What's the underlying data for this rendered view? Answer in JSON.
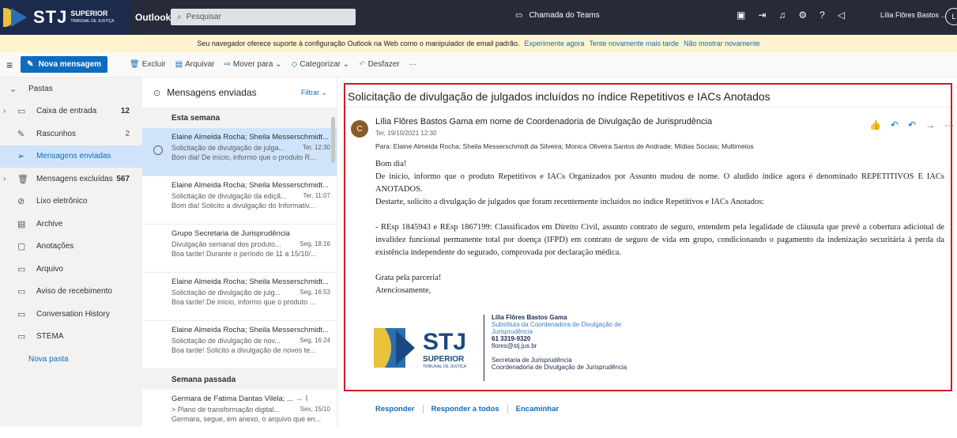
{
  "header": {
    "org": "STJ",
    "org_sub": "SUPERIOR",
    "org_sub2": "TRIBUNAL DE JUSTIÇA",
    "app": "Outlook",
    "search_placeholder": "Pesquisar",
    "teams": "Chamada do Teams",
    "user": "Lília Flôres Bastos ..."
  },
  "banner": {
    "text": "Seu navegador oferece suporte à configuração Outlook na Web como o manipulador de email padrão.",
    "try": "Experimente agora",
    "retry": "Tente novamente mais tarde",
    "never": "Não mostrar novamente"
  },
  "commands": {
    "new_message": "Nova mensagem",
    "delete": "Excluir",
    "archive": "Arquivar",
    "move": "Mover para",
    "categorize": "Categorizar",
    "undo": "Desfazer"
  },
  "sidebar": {
    "title": "Pastas",
    "items": [
      {
        "label": "Caixa de entrada",
        "count": "12"
      },
      {
        "label": "Rascunhos",
        "count": "2"
      },
      {
        "label": "Mensagens enviadas",
        "count": ""
      },
      {
        "label": "Mensagens excluídas",
        "count": "567"
      },
      {
        "label": "Lixo eletrônico",
        "count": ""
      },
      {
        "label": "Archive",
        "count": ""
      },
      {
        "label": "Anotações",
        "count": ""
      },
      {
        "label": "Arquivo",
        "count": ""
      },
      {
        "label": "Aviso de recebimento",
        "count": ""
      },
      {
        "label": "Conversation History",
        "count": ""
      },
      {
        "label": "STEMA",
        "count": ""
      }
    ],
    "new_folder": "Nova pasta"
  },
  "list": {
    "title": "Mensagens enviadas",
    "filter": "Filtrar",
    "group1": "Esta semana",
    "group2": "Semana passada",
    "messages": [
      {
        "sender": "Elaine Almeida Rocha; Sheila Messerschmidt...",
        "subject": "Solicitação de divulgação de julga...",
        "date": "Ter, 12:30",
        "preview": "Bom dia! De início, informo que o produto R..."
      },
      {
        "sender": "Elaine Almeida Rocha; Sheila Messerschmidt...",
        "subject": "Solicitação de divulgação da ediçã...",
        "date": "Ter, 11:07",
        "preview": "Bom dia! Solicito a divulgação do Informativ..."
      },
      {
        "sender": "Grupo Secretaria de Jurisprudência",
        "subject": "Divulgação semanal dos produto...",
        "date": "Seg, 18:16",
        "preview": "Boa tarde! Durante o período de 11 a 15/10/..."
      },
      {
        "sender": "Elaine Almeida Rocha; Sheila Messerschmidt...",
        "subject": "Solicitação de divulgação de julg...",
        "date": "Seg, 16:53",
        "preview": "Boa tarde! De início, informo que o produto ..."
      },
      {
        "sender": "Elaine Almeida Rocha; Sheila Messerschmidt...",
        "subject": "Solicitação de divulgação de nov...",
        "date": "Seg, 16:24",
        "preview": "Boa tarde! Solicito a divulgação de novos te..."
      },
      {
        "sender": "Germara de Fatima Dantas Vilela; ...",
        "subject": "> Plano de transformação digital...",
        "date": "Sex, 15/10",
        "preview": "Germara, segue, em anexo, o arquivo que en..."
      }
    ]
  },
  "email": {
    "subject": "Solicitação de divulgação de julgados incluídos no índice Repetitivos e IACs Anotados",
    "avatar": "C",
    "from": "Lília Flôres Bastos Gama em nome de Coordenadoria de Divulgação de Jurisprudência",
    "date": "Ter, 19/10/2021 12:30",
    "to": "Para:  Elaine Almeida Rocha; Sheila Messerschmidt da Silveira; Monica Oliveira Santos de Andrade; Mídias Sociais; Multimeios",
    "p1": "Bom dia!",
    "p2": "De início, informo que o produto Repetitivos e IACs Organizados por Assunto mudou de nome. O aludido índice agora é denominado REPETITIVOS E IACs ANOTADOS.",
    "p3": "Destarte, solicito a divulgação de julgados que foram recentemente incluídos no índice Repetitivos e IACs Anotados:",
    "p4": "- REsp 1845943 e REsp 1867199: Classificados em Direito Civil, assunto contrato de seguro, entendem pela legalidade de cláusula que prevê a cobertura adicional de invalidez funcional permanente total por doença (IFPD) em contrato de seguro de vida em grupo, condicionando o pagamento da indenização securitária à perda da existência independente do segurado, comprovada por declaração médica.",
    "p5": "Grata pela parceria!",
    "p6": "Atenciosamente,",
    "sig_name": "Lília Flôres Bastos Gama",
    "sig_role": "Substituta da Coordenadora de Divulgação de Jurisprudência",
    "sig_phone": "61 3319-9320",
    "sig_email": "flores@stj.jus.br",
    "sig_dept1": "Secretaria de Jurisprudência",
    "sig_dept2": "Coordenadoria de Divulgação de Jurisprudência",
    "reply": "Responder",
    "reply_all": "Responder a todos",
    "forward": "Encaminhar"
  }
}
